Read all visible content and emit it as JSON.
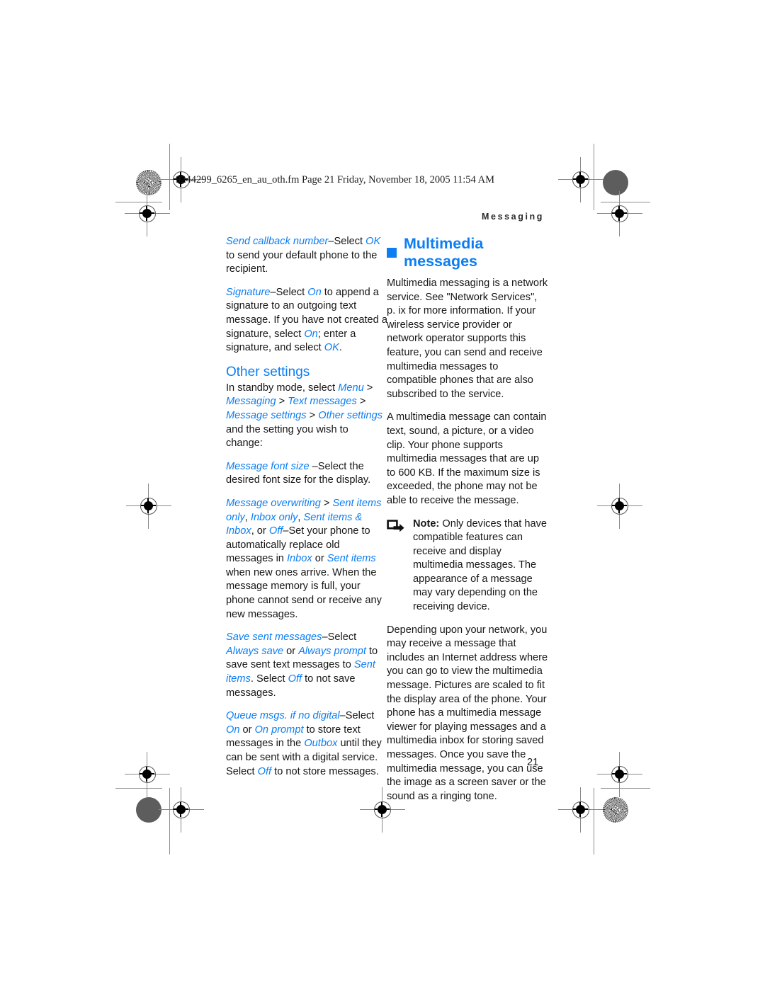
{
  "page": {
    "filestamp": "9244299_6265_en_au_oth.fm  Page 21  Friday, November 18, 2005  11:54 AM",
    "running_head": "Messaging",
    "folio": "21",
    "accent_color": "#0c7ef2",
    "text_color": "#161616"
  },
  "left_column": {
    "p_send_callback": {
      "term": "Send callback number",
      "dash": "–",
      "lead": "Select ",
      "value": "OK",
      "rest": " to send your default phone to the recipient."
    },
    "p_signature": {
      "term": "Signature",
      "dash": "–",
      "lead": "Select ",
      "value_on": "On",
      "mid1": " to append a signature to an outgoing text message. If you have not created a signature, select ",
      "value_on2": "On",
      "mid2": "; enter a signature, and select ",
      "value_ok": "OK",
      "end": "."
    },
    "section_heading": "Other settings",
    "p_standby": {
      "lead": "In standby mode, select ",
      "menu": "Menu",
      "sep1": " > ",
      "messaging": "Messaging",
      "sep2": " > ",
      "text_messages": "Text messages",
      "sep3": " > ",
      "message_settings": "Message settings",
      "sep4": " > ",
      "other_settings": "Other settings",
      "rest": " and the setting you wish to change:"
    },
    "p_font_size": {
      "term": "Message font size",
      "rest": " –Select the desired font size for the display."
    },
    "p_overwriting": {
      "term": "Message overwriting",
      "sep": " > ",
      "opt1": "Sent items only",
      "c1": ", ",
      "opt2": "Inbox only",
      "c2": ", ",
      "opt3": "Sent items & Inbox",
      "c3": ", or ",
      "opt4": "Off",
      "dash": "–",
      "body1": "Set your phone to automatically replace old messages in ",
      "inbox": "Inbox",
      "or": " or ",
      "sent_items": "Sent items",
      "body2": " when new ones arrive. When the message memory is full, your phone cannot send or receive any new messages."
    },
    "p_save_sent": {
      "term": "Save sent messages",
      "dash": "–",
      "lead": "Select ",
      "opt1": "Always save",
      "or": " or ",
      "opt2": "Always prompt",
      "mid": " to save sent text messages to ",
      "sent_items": "Sent items",
      "mid2": ". Select ",
      "off": "Off",
      "end": " to not save messages."
    },
    "p_queue": {
      "term": "Queue msgs. if no digital",
      "dash": "–",
      "lead": "Select ",
      "on": "On",
      "or": " or ",
      "on_prompt": "On prompt",
      "mid": " to store text messages in the ",
      "outbox": "Outbox",
      "mid2": " until they can be sent with a digital service. Select ",
      "off": "Off",
      "end": " to not store messages."
    }
  },
  "right_column": {
    "chapter_heading": "Multimedia messages",
    "p_intro": "Multimedia messaging is a network service. See \"Network Services\", p. ix for more information. If your wireless service provider or network operator supports this feature, you can send and receive multimedia messages to compatible phones that are also subscribed to the service.",
    "p_contain": "A multimedia message can contain text, sound, a picture, or a video clip. Your phone supports multimedia messages that are up to 600 KB. If the maximum size is exceeded, the phone may not be able to receive the message.",
    "note": {
      "icon": "note-arrow-icon",
      "label": "Note:",
      "text": " Only devices that have compatible features can receive and display multimedia messages. The appearance of a message may vary depending on the receiving device."
    },
    "p_depending": "Depending upon your network, you may receive a message that includes an Internet address where you can go to view the multimedia message. Pictures are scaled to fit the display area of the phone. Your phone has a multimedia message viewer for playing messages and a multimedia inbox for storing saved messages. Once you save the multimedia message, you can use the image as a screen saver or the sound as a ringing tone."
  }
}
